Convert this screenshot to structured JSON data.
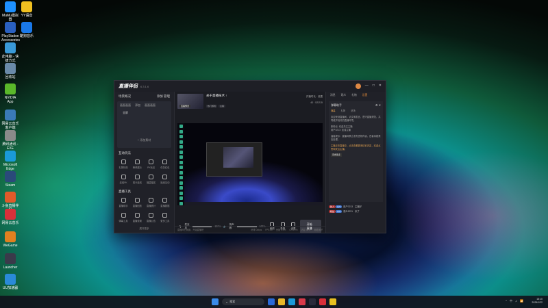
{
  "desktop": {
    "icons": [
      {
        "label": "MuMu模拟器",
        "color": "#1e90ff"
      },
      {
        "label": "YY语音",
        "color": "#f0c020"
      },
      {
        "label": "PlayStation Accessories",
        "color": "#2a60c0"
      },
      {
        "label": "酷狗音乐",
        "color": "#1a78e8"
      },
      {
        "label": "此电脑 - 快捷方式",
        "color": "#3a9ad8"
      },
      {
        "label": "回收站",
        "color": "#6a8aa8"
      },
      {
        "label": "NVIDIA App",
        "color": "#5ab82a"
      },
      {
        "label": "网易云音乐客户端",
        "color": "#3a7ab8"
      },
      {
        "label": "腾讯通讯 - EXE",
        "color": "#8a8a8a"
      },
      {
        "label": "Microsoft Edge",
        "color": "#1a9ad8"
      },
      {
        "label": "Steam",
        "color": "#2a4a7a"
      },
      {
        "label": "斗鱼直播伴侣",
        "color": "#e05a2a"
      },
      {
        "label": "网易云音乐",
        "color": "#d8303a"
      },
      {
        "label": "WeGame",
        "color": "#e08020"
      },
      {
        "label": "Launcher",
        "color": "#3a3a4a"
      },
      {
        "label": "UU加速器",
        "color": "#2a8ad8"
      }
    ]
  },
  "app": {
    "brand": "直播伴侣",
    "version": "6.3.1.6",
    "window_buttons": [
      "—",
      "□",
      "✕"
    ],
    "left": {
      "scene_header": "场景概况",
      "scene_actions": [
        "添加",
        "管理"
      ],
      "scene_tabs": [
        "画面画面",
        "添加",
        "画面画面"
      ],
      "scene_item": "全屏",
      "add_source": "+ 添加素材",
      "interaction_title": "互动玩法",
      "interaction_items": [
        "礼物特效",
        "榜单展示",
        "PK玩法",
        "任务红包",
        "连线PK",
        "观众连线",
        "福袋抽奖",
        "贴纸互动"
      ],
      "tools_title": "直播工具",
      "tool_items": [
        "直播助手",
        "直播回放",
        "直播统计",
        "直播数据",
        "弹幕工具",
        "直播设置",
        "直播公告",
        "更多工具"
      ],
      "more": "展开更多"
    },
    "center": {
      "thumb_label": "直播预览",
      "title": "关于直播技术 ↑",
      "tags": [
        "热门游戏",
        "主播"
      ],
      "stats": [
        "开播时长",
        "设置",
        "40",
        "52/215"
      ],
      "mic_label": "麦克风",
      "mic_value": "100%",
      "speaker_label": "扬声器",
      "speaker_value": "100%",
      "mic_fill": 1.0,
      "speaker_fill": 1.0,
      "ctrl_buttons": [
        "美颜",
        "录制",
        "设置"
      ],
      "go_live": "开始直播",
      "status": [
        "直播间已就绪，开始直播吧",
        "码率 0kbps",
        "FPS 60",
        "丢帧 0.0%",
        "CPU 2%",
        "内存 32%",
        "网络良好"
      ]
    },
    "right": {
      "tabs": [
        "消息",
        "观众",
        "礼物",
        "设置"
      ],
      "danmu_header": "弹幕助手",
      "danmu_sub": [
        "弹幕",
        "礼物",
        "进场"
      ],
      "danmu_text": "欢迎来到直播间，请文明发言，遵守直播规范，共同维护良好的直播环境。",
      "line1": "新粉丝: 欢迎关注主播",
      "line2": "用户0213: 加油主播",
      "notice": "温馨提示：直播间禁止发布违规内容，违者将被禁言处理。",
      "highlight": "主播正在直播中，点击查看更多精彩内容，欢迎点赞和关注主播。",
      "btn": "查看更多",
      "chat": [
        {
          "badge": "新人",
          "badge2": "LV3",
          "name": "用户0213",
          "text": "主播好"
        },
        {
          "badge": "粉丝",
          "badge2": "LV5",
          "name": "观众5231",
          "text": "来了"
        }
      ]
    }
  },
  "taskbar": {
    "search": "搜索",
    "time": "18:10",
    "date": "2025/1/22",
    "tray": [
      "^",
      "中",
      "♫",
      "📶"
    ]
  }
}
